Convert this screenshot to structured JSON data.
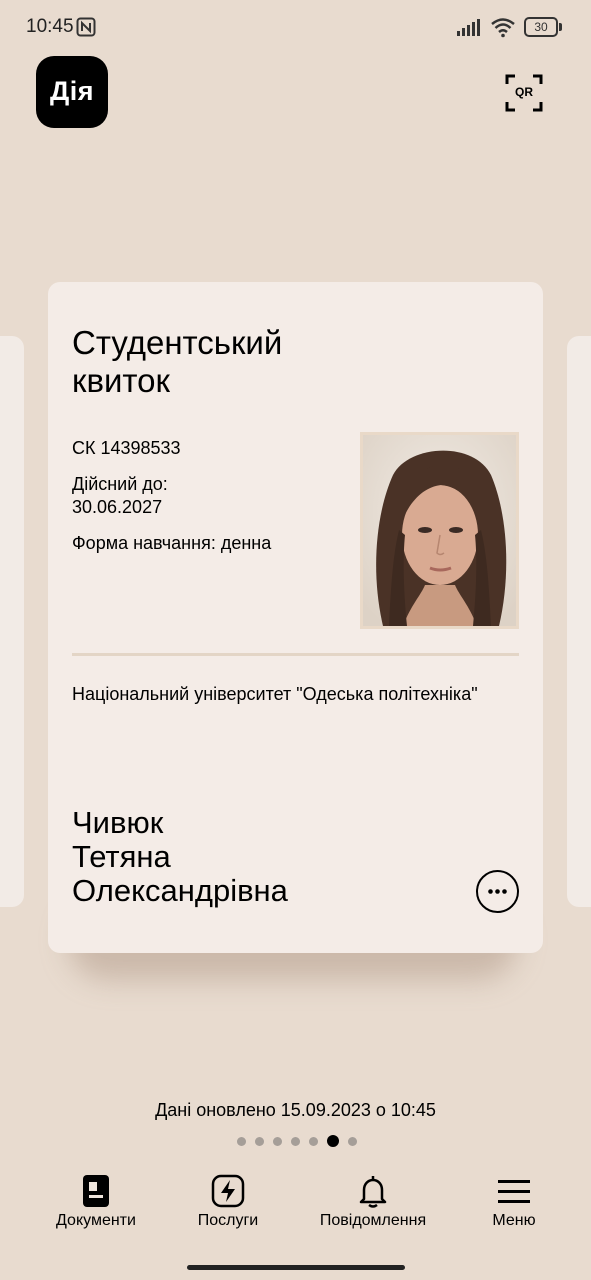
{
  "status_bar": {
    "time": "10:45",
    "battery": "30"
  },
  "app": {
    "logo": "Дія"
  },
  "header": {
    "qr_label": "QR"
  },
  "document": {
    "title": "Студентський квиток",
    "number": "СК 14398533",
    "valid_label": "Дійсний до:",
    "valid_date": "30.06.2027",
    "study_form": "Форма навчання: денна",
    "university": "Національний університет \"Одеська політехніка\"",
    "name_lines": [
      "Чивюк",
      "Тетяна",
      "Олександрівна"
    ]
  },
  "footer": {
    "updated": "Дані оновлено 15.09.2023 о 10:45",
    "pager": {
      "count": 7,
      "active_index": 5
    }
  },
  "nav": [
    {
      "label": "Документи",
      "icon": "documents-icon"
    },
    {
      "label": "Послуги",
      "icon": "services-icon"
    },
    {
      "label": "Повідомлення",
      "icon": "bell-icon"
    },
    {
      "label": "Меню",
      "icon": "menu-icon"
    }
  ]
}
